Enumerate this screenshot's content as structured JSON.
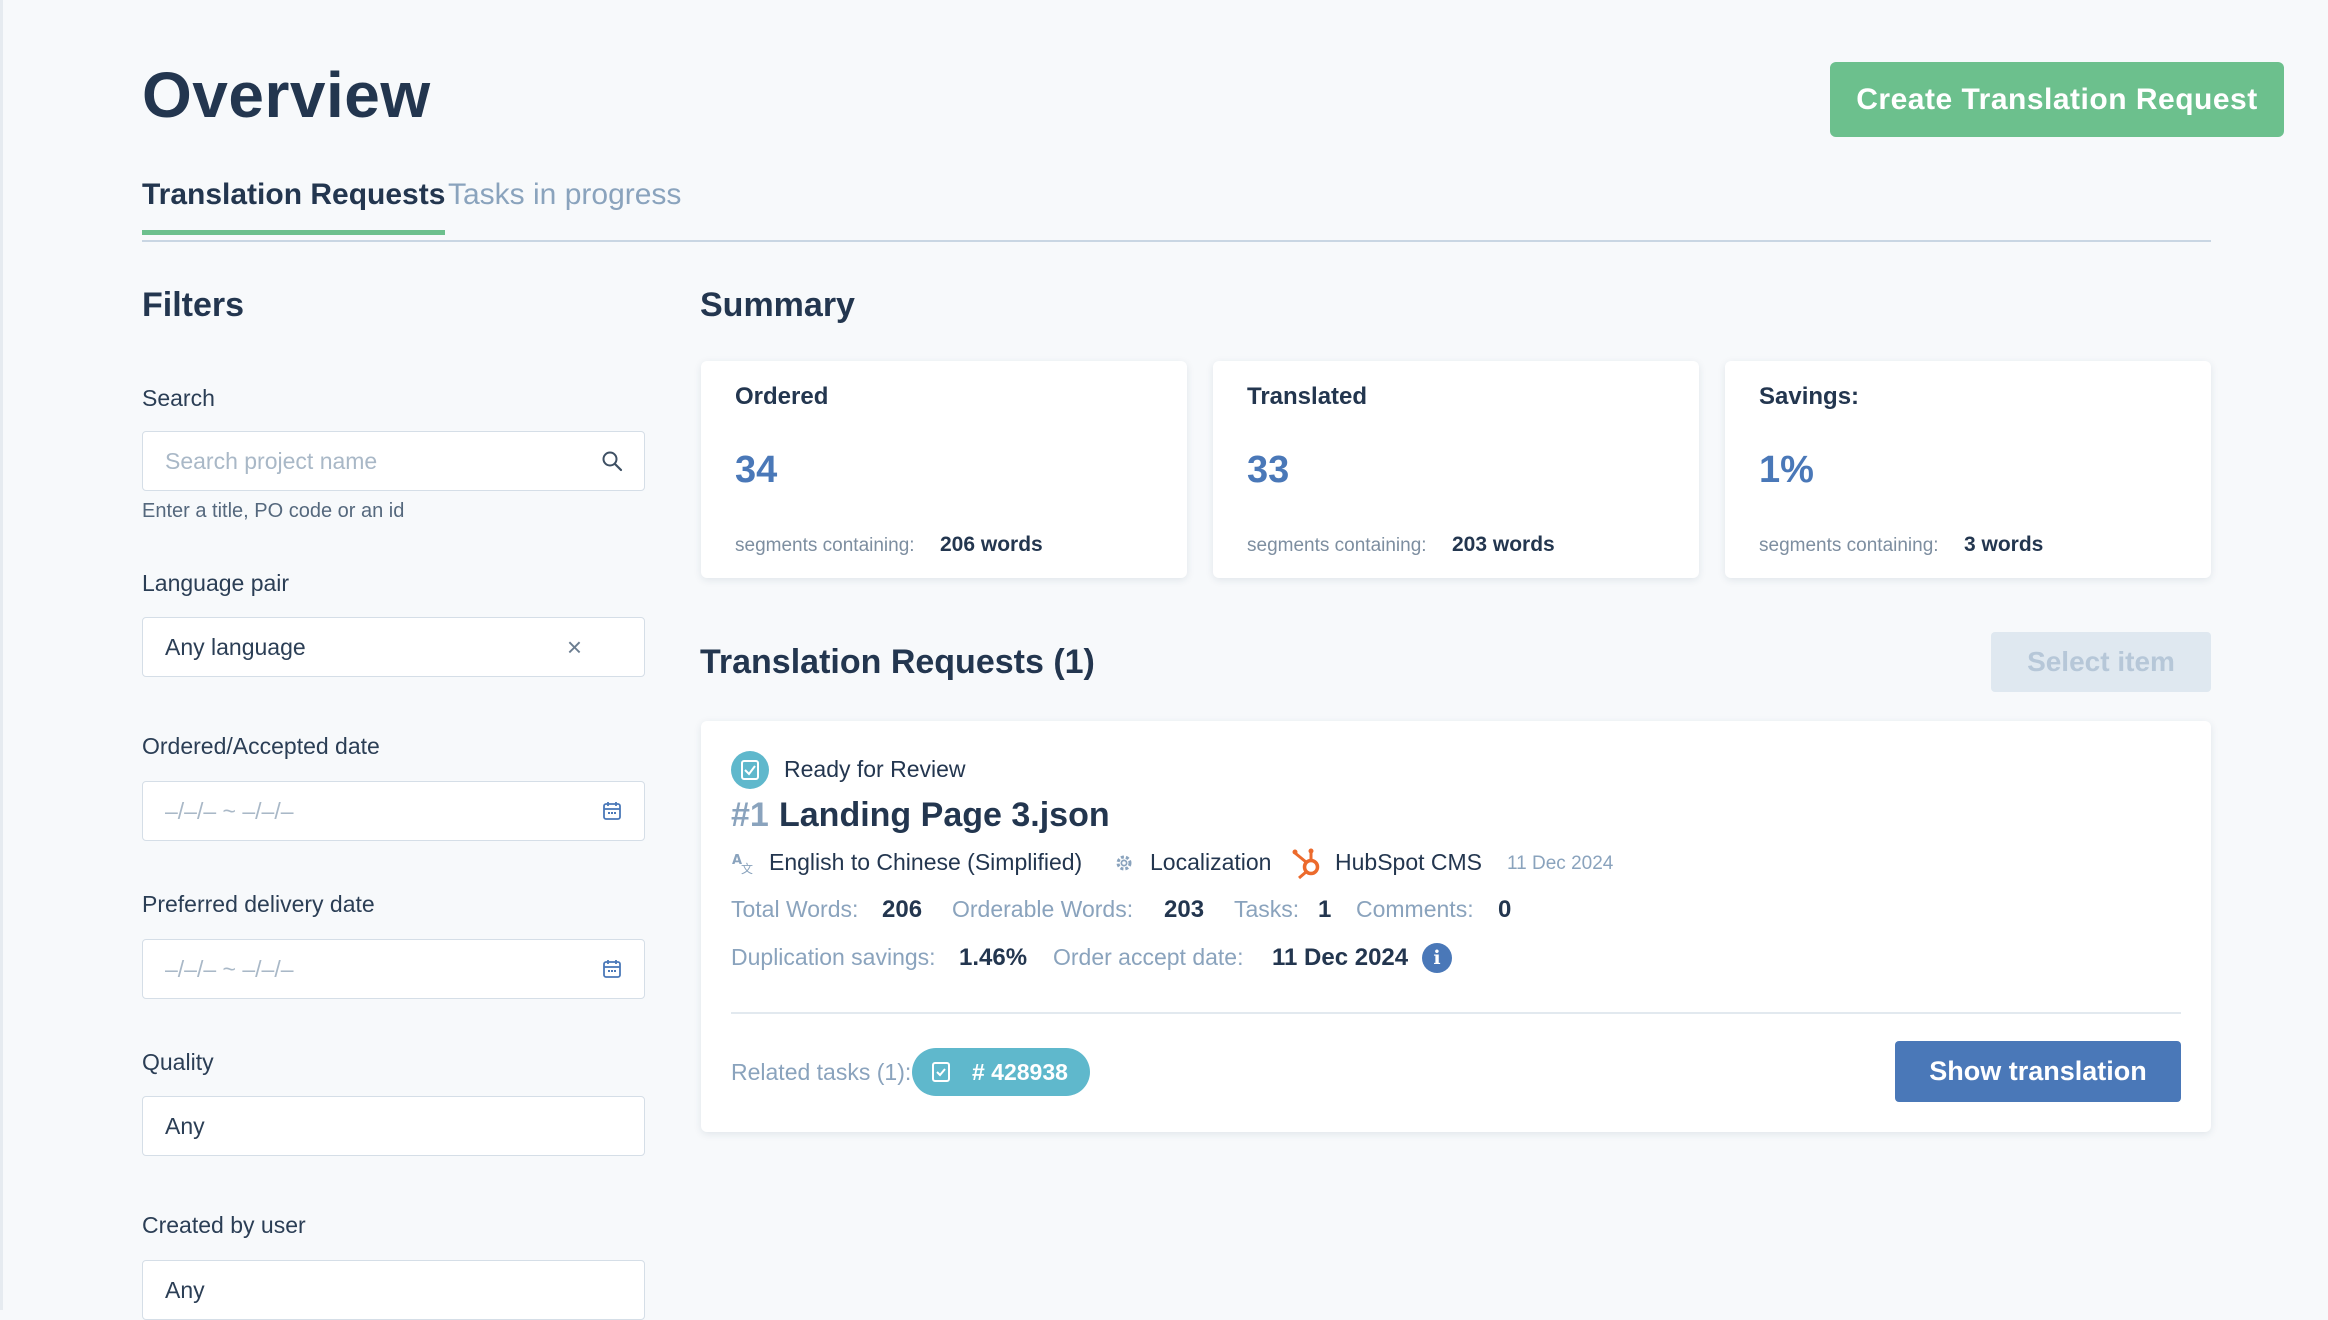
{
  "header": {
    "title": "Overview",
    "create_button": "Create Translation Request"
  },
  "tabs": [
    {
      "label": "Translation Requests",
      "active": true
    },
    {
      "label": "Tasks in progress",
      "active": false
    }
  ],
  "filters": {
    "title": "Filters",
    "search": {
      "label": "Search",
      "placeholder": "Search project name",
      "hint": "Enter a title, PO code or an id"
    },
    "language_pair": {
      "label": "Language pair",
      "value": "Any language",
      "clear": "×"
    },
    "ordered_date": {
      "label": "Ordered/Accepted date",
      "placeholder": "–/–/– ~ –/–/–"
    },
    "delivery_date": {
      "label": "Preferred delivery date",
      "placeholder": "–/–/– ~ –/–/–"
    },
    "quality": {
      "label": "Quality",
      "value": "Any"
    },
    "created_by": {
      "label": "Created by user",
      "value": "Any"
    }
  },
  "summary": {
    "title": "Summary",
    "cards": [
      {
        "title": "Ordered",
        "value": "34",
        "sub": "segments containing:",
        "words": "206 words"
      },
      {
        "title": "Translated",
        "value": "33",
        "sub": "segments containing:",
        "words": "203 words"
      },
      {
        "title": "Savings:",
        "value": "1%",
        "sub": "segments containing:",
        "words": "3 words"
      }
    ]
  },
  "requests": {
    "title": "Translation Requests (1)",
    "select_button": "Select item",
    "items": [
      {
        "status": "Ready for Review",
        "number": "#1",
        "name": "Landing Page 3.json",
        "language": "English to Chinese (Simplified)",
        "type": "Localization",
        "source": "HubSpot CMS",
        "date": "11 Dec 2024",
        "total_words_label": "Total Words:",
        "total_words": "206",
        "orderable_words_label": "Orderable Words:",
        "orderable_words": "203",
        "tasks_label": "Tasks:",
        "tasks": "1",
        "comments_label": "Comments:",
        "comments": "0",
        "dup_savings_label": "Duplication savings:",
        "dup_savings": "1.46%",
        "accept_date_label": "Order accept date:",
        "accept_date": "11 Dec 2024",
        "related_label": "Related tasks (1):",
        "related_task": "# 428938",
        "show_button": "Show translation"
      }
    ]
  },
  "colors": {
    "accent_green": "#6cc08d",
    "accent_blue": "#4a78b8",
    "chip_teal": "#5fb8cc",
    "hubspot_orange": "#ec6a2c"
  }
}
